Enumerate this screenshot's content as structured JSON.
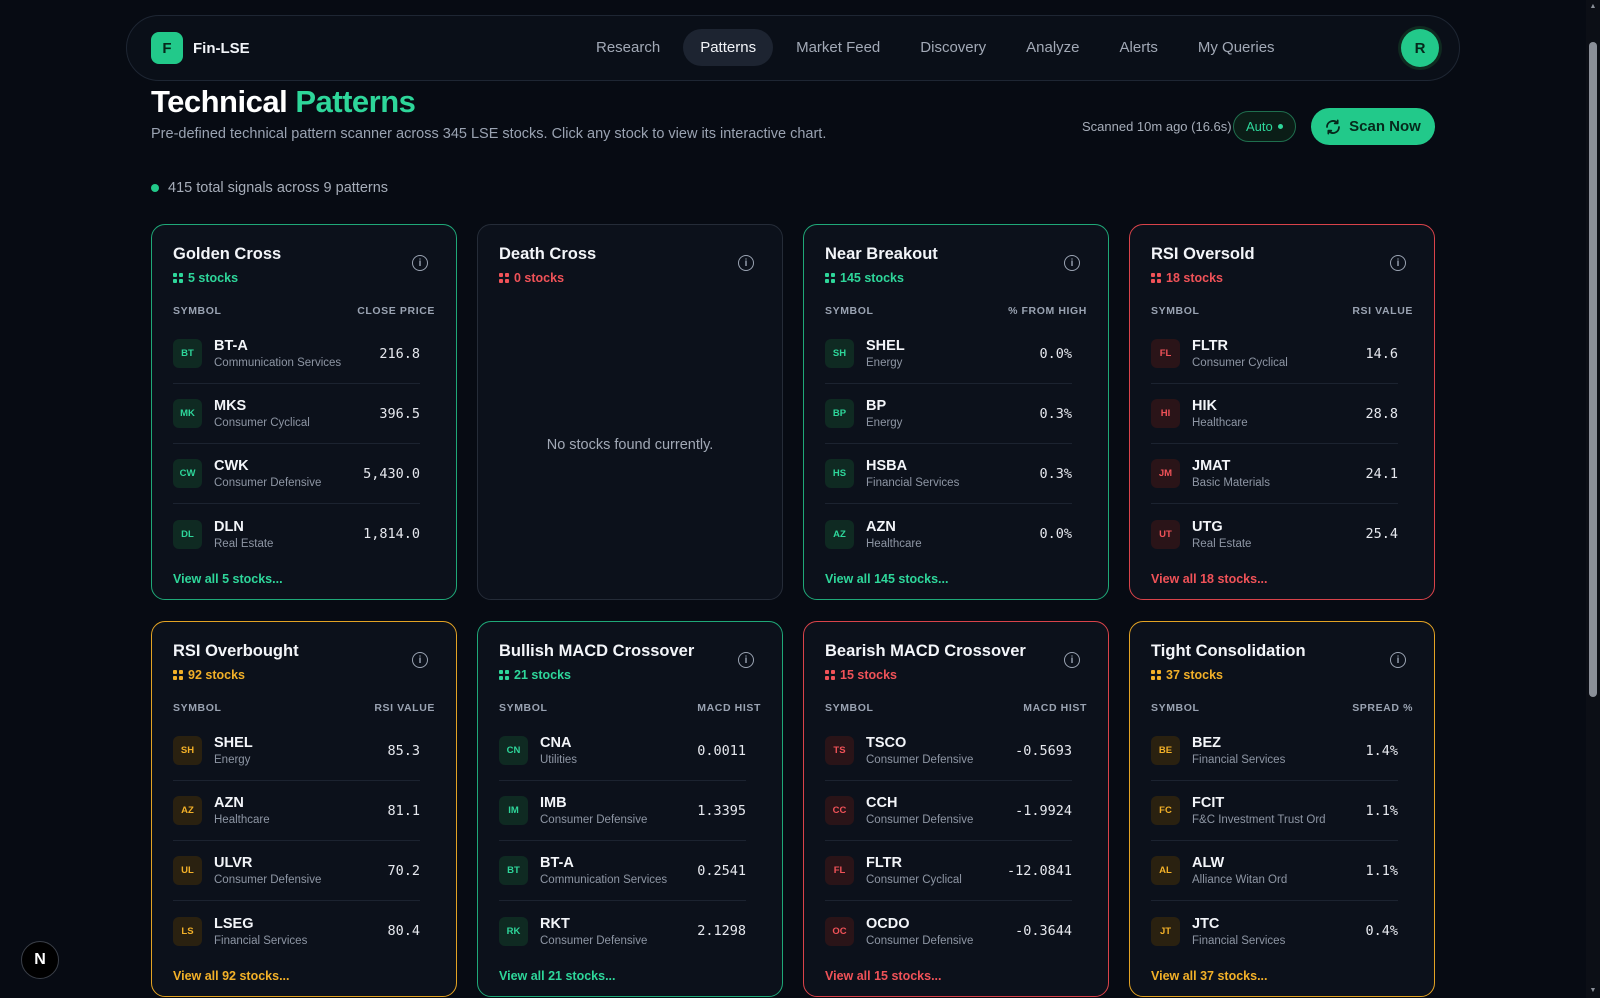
{
  "brand": {
    "logo_letter": "F",
    "name": "Fin-LSE"
  },
  "nav": {
    "links": [
      "Research",
      "Patterns",
      "Market Feed",
      "Discovery",
      "Analyze",
      "Alerts",
      "My Queries"
    ],
    "active_index": 1
  },
  "user": {
    "initial": "R"
  },
  "header": {
    "title_main": "Technical",
    "title_accent": "Patterns",
    "subtitle": "Pre-defined technical pattern scanner across 345 LSE stocks. Click any stock to view its interactive chart.",
    "scan_meta": "Scanned 10m ago (16.6s)",
    "auto_label": "Auto",
    "scan_button": "Scan Now",
    "signals": "415 total signals across 9 patterns"
  },
  "colors": {
    "green": "#2ed69a",
    "red": "#f05258",
    "amber": "#f2b028",
    "background": "#070b13"
  },
  "cards": [
    {
      "title": "Golden Cross",
      "count": "5 stocks",
      "theme": "green",
      "col_left": "SYMBOL",
      "col_right": "CLOSE PRICE",
      "rows": [
        {
          "badge": "BT",
          "symbol": "BT-A",
          "sector": "Communication Services",
          "value": "216.8"
        },
        {
          "badge": "MK",
          "symbol": "MKS",
          "sector": "Consumer Cyclical",
          "value": "396.5"
        },
        {
          "badge": "CW",
          "symbol": "CWK",
          "sector": "Consumer Defensive",
          "value": "5,430.0"
        },
        {
          "badge": "DL",
          "symbol": "DLN",
          "sector": "Real Estate",
          "value": "1,814.0"
        }
      ],
      "view_all": "View all 5 stocks..."
    },
    {
      "title": "Death Cross",
      "count": "0 stocks",
      "theme": "neutral",
      "count_theme": "red",
      "empty": "No stocks found currently.",
      "rows": []
    },
    {
      "title": "Near Breakout",
      "count": "145 stocks",
      "theme": "green",
      "col_left": "SYMBOL",
      "col_right": "% FROM HIGH",
      "rows": [
        {
          "badge": "SH",
          "symbol": "SHEL",
          "sector": "Energy",
          "value": "0.0%"
        },
        {
          "badge": "BP",
          "symbol": "BP",
          "sector": "Energy",
          "value": "0.3%"
        },
        {
          "badge": "HS",
          "symbol": "HSBA",
          "sector": "Financial Services",
          "value": "0.3%"
        },
        {
          "badge": "AZ",
          "symbol": "AZN",
          "sector": "Healthcare",
          "value": "0.0%"
        }
      ],
      "view_all": "View all 145 stocks..."
    },
    {
      "title": "RSI Oversold",
      "count": "18 stocks",
      "theme": "red",
      "col_left": "SYMBOL",
      "col_right": "RSI VALUE",
      "rows": [
        {
          "badge": "FL",
          "symbol": "FLTR",
          "sector": "Consumer Cyclical",
          "value": "14.6"
        },
        {
          "badge": "HI",
          "symbol": "HIK",
          "sector": "Healthcare",
          "value": "28.8"
        },
        {
          "badge": "JM",
          "symbol": "JMAT",
          "sector": "Basic Materials",
          "value": "24.1"
        },
        {
          "badge": "UT",
          "symbol": "UTG",
          "sector": "Real Estate",
          "value": "25.4"
        }
      ],
      "view_all": "View all 18 stocks..."
    },
    {
      "title": "RSI Overbought",
      "count": "92 stocks",
      "theme": "amber",
      "col_left": "SYMBOL",
      "col_right": "RSI VALUE",
      "rows": [
        {
          "badge": "SH",
          "symbol": "SHEL",
          "sector": "Energy",
          "value": "85.3"
        },
        {
          "badge": "AZ",
          "symbol": "AZN",
          "sector": "Healthcare",
          "value": "81.1"
        },
        {
          "badge": "UL",
          "symbol": "ULVR",
          "sector": "Consumer Defensive",
          "value": "70.2"
        },
        {
          "badge": "LS",
          "symbol": "LSEG",
          "sector": "Financial Services",
          "value": "80.4"
        }
      ],
      "view_all": "View all 92 stocks..."
    },
    {
      "title": "Bullish MACD Crossover",
      "count": "21 stocks",
      "theme": "green",
      "col_left": "SYMBOL",
      "col_right": "MACD HIST",
      "rows": [
        {
          "badge": "CN",
          "symbol": "CNA",
          "sector": "Utilities",
          "value": "0.0011"
        },
        {
          "badge": "IM",
          "symbol": "IMB",
          "sector": "Consumer Defensive",
          "value": "1.3395"
        },
        {
          "badge": "BT",
          "symbol": "BT-A",
          "sector": "Communication Services",
          "value": "0.2541"
        },
        {
          "badge": "RK",
          "symbol": "RKT",
          "sector": "Consumer Defensive",
          "value": "2.1298"
        }
      ],
      "view_all": "View all 21 stocks..."
    },
    {
      "title": "Bearish MACD Crossover",
      "count": "15 stocks",
      "theme": "red",
      "col_left": "SYMBOL",
      "col_right": "MACD HIST",
      "rows": [
        {
          "badge": "TS",
          "symbol": "TSCO",
          "sector": "Consumer Defensive",
          "value": "-0.5693"
        },
        {
          "badge": "CC",
          "symbol": "CCH",
          "sector": "Consumer Defensive",
          "value": "-1.9924"
        },
        {
          "badge": "FL",
          "symbol": "FLTR",
          "sector": "Consumer Cyclical",
          "value": "-12.0841"
        },
        {
          "badge": "OC",
          "symbol": "OCDO",
          "sector": "Consumer Defensive",
          "value": "-0.3644"
        }
      ],
      "view_all": "View all 15 stocks..."
    },
    {
      "title": "Tight Consolidation",
      "count": "37 stocks",
      "theme": "amber",
      "col_left": "SYMBOL",
      "col_right": "SPREAD %",
      "rows": [
        {
          "badge": "BE",
          "symbol": "BEZ",
          "sector": "Financial Services",
          "value": "1.4%"
        },
        {
          "badge": "FC",
          "symbol": "FCIT",
          "sector": "F&C Investment Trust Ord",
          "value": "1.1%"
        },
        {
          "badge": "AL",
          "symbol": "ALW",
          "sector": "Alliance Witan Ord",
          "value": "1.1%"
        },
        {
          "badge": "JT",
          "symbol": "JTC",
          "sector": "Financial Services",
          "value": "0.4%"
        }
      ],
      "view_all": "View all 37 stocks..."
    }
  ],
  "dev_badge": "N"
}
